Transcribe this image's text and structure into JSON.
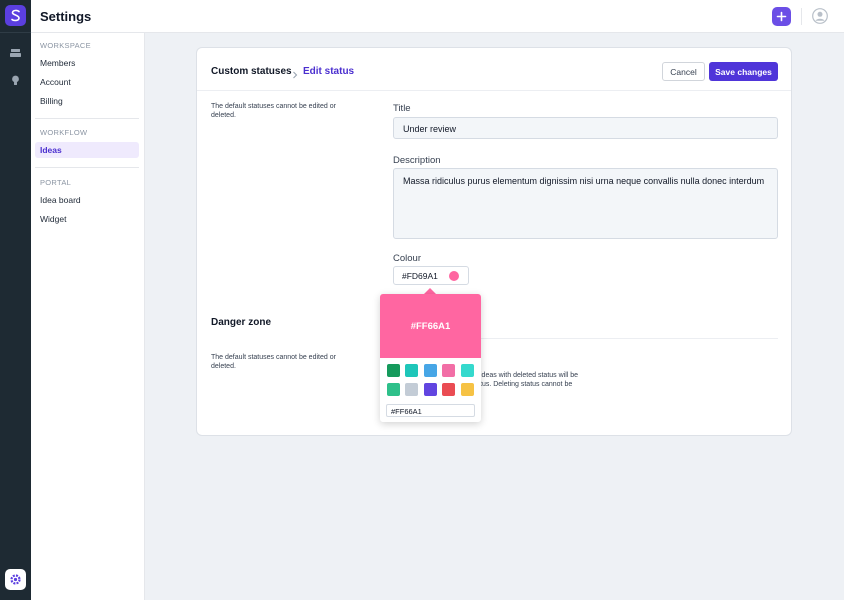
{
  "app": {
    "title": "Settings"
  },
  "sidebar": {
    "sections": [
      {
        "title": "WORKSPACE",
        "items": [
          "Members",
          "Account",
          "Billing"
        ]
      },
      {
        "title": "WORKFLOW",
        "items": [
          "Ideas"
        ]
      },
      {
        "title": "PORTAL",
        "items": [
          "Idea board",
          "Widget"
        ]
      }
    ],
    "active_item": "Ideas"
  },
  "breadcrumb": {
    "parent": "Custom statuses",
    "current": "Edit status"
  },
  "actions": {
    "cancel_label": "Cancel",
    "save_label": "Save changes"
  },
  "form": {
    "note": "The default statuses cannot be edited or deleted.",
    "title_label": "Title",
    "title_value": "Under review",
    "description_label": "Description",
    "description_value": "Massa ridiculus purus elementum dignissim nisi urna neque convallis nulla donec interdum",
    "colour_label": "Colour",
    "colour_value": "#FD69A1"
  },
  "danger": {
    "title": "Danger zone",
    "note": "The default statuses cannot be edited or deleted.",
    "description_fragment": "ideas with deleted status will be\ntus. Deleting status cannot be"
  },
  "color_picker": {
    "selected_hex": "#FF66A1",
    "input_value": "#FF66A1",
    "swatches": [
      "#159a5c",
      "#1ec6b9",
      "#47a6e6",
      "#f26ea6",
      "#35d9cd",
      "#2ec08a",
      "#c3ccd6",
      "#6145e0",
      "#ea4c53",
      "#f6c244"
    ]
  },
  "colors": {
    "accent": "#4f35d9",
    "rail": "#1e2a33",
    "active_bg": "#efeafd"
  }
}
